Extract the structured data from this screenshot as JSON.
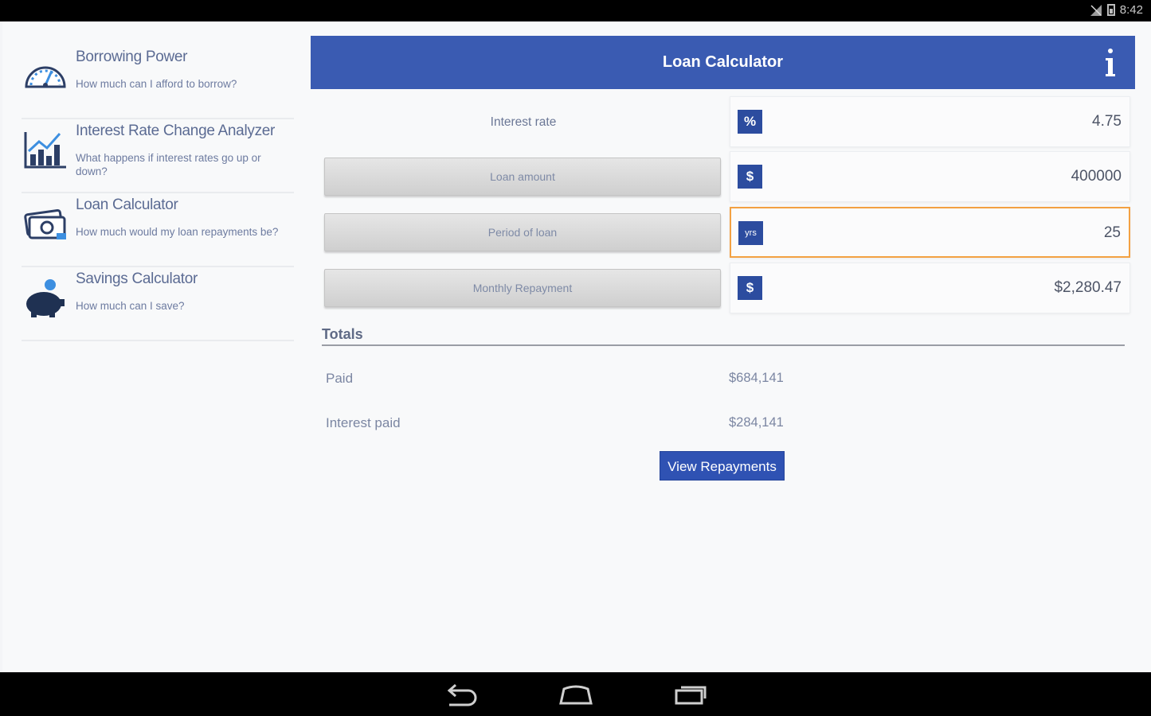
{
  "status_bar": {
    "time": "8:42"
  },
  "sidebar": {
    "items": [
      {
        "title": "Borrowing Power",
        "subtitle": "How much can I afford to borrow?",
        "icon": "speedometer-icon"
      },
      {
        "title": "Interest Rate Change Analyzer",
        "subtitle": "What happens if interest rates go up or down?",
        "icon": "bar-chart-icon"
      },
      {
        "title": "Loan Calculator",
        "subtitle": "How much would my loan repayments be?",
        "icon": "money-icon"
      },
      {
        "title": "Savings Calculator",
        "subtitle": "How much can I save?",
        "icon": "piggy-bank-icon"
      }
    ]
  },
  "header": {
    "title": "Loan Calculator",
    "info_icon": "info-icon"
  },
  "form": {
    "interest_rate": {
      "label": "Interest rate",
      "unit": "%",
      "value": "4.75"
    },
    "loan_amount": {
      "label": "Loan amount",
      "unit": "$",
      "value": "400000"
    },
    "period_of_loan": {
      "label": "Period of loan",
      "unit": "yrs",
      "value": "25"
    },
    "monthly_repayment": {
      "label": "Monthly Repayment",
      "unit": "$",
      "value": "$2,280.47"
    }
  },
  "totals": {
    "title": "Totals",
    "paid_label": "Paid",
    "paid_value": "$684,141",
    "interest_paid_label": "Interest paid",
    "interest_paid_value": "$284,141"
  },
  "view_repayments_label": "View Repayments",
  "nav_bar": {
    "icons": [
      "back-icon",
      "home-icon",
      "recents-icon"
    ]
  },
  "colors": {
    "accent": "#3a5bb2",
    "unit_badge": "#2c4c9f",
    "focus": "#f3a142"
  }
}
